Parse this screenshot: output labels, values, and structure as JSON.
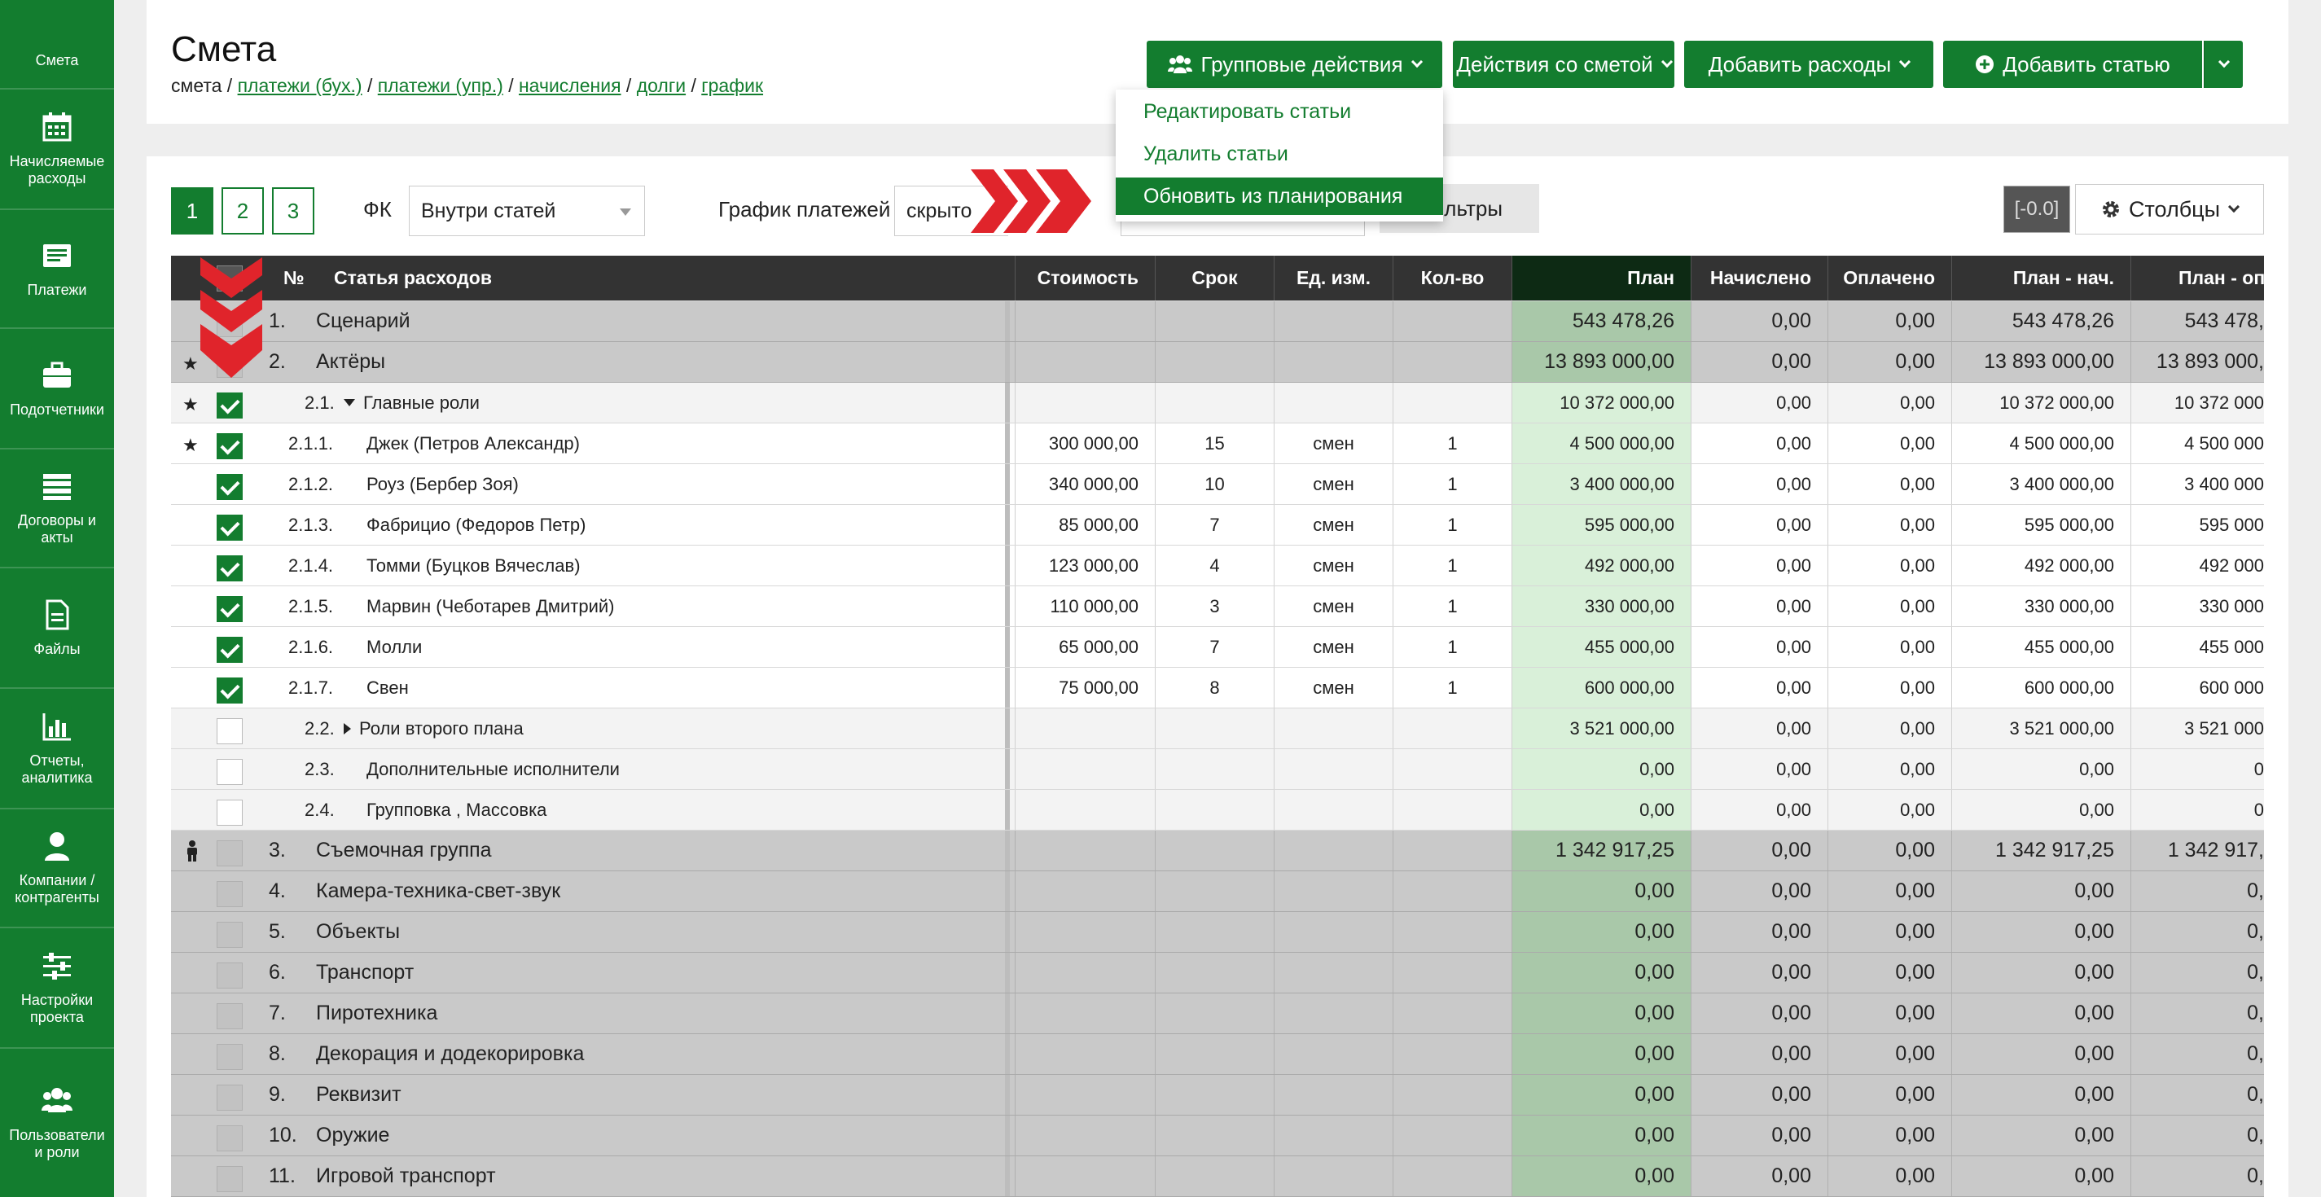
{
  "sidebar": {
    "items": [
      {
        "label": "Смета",
        "icon": "estimate-icon"
      },
      {
        "label": "Начисляемые расходы",
        "icon": "calendar-icon"
      },
      {
        "label": "Платежи",
        "icon": "payments-icon"
      },
      {
        "label": "Подотчетники",
        "icon": "briefcase-icon"
      },
      {
        "label": "Договоры и акты",
        "icon": "list-icon"
      },
      {
        "label": "Файлы",
        "icon": "file-icon"
      },
      {
        "label": "Отчеты, аналитика",
        "icon": "bar-chart-icon"
      },
      {
        "label": "Компании / контрагенты",
        "icon": "user-icon"
      },
      {
        "label": "Настройки проекта",
        "icon": "sliders-icon"
      },
      {
        "label": "Пользователи и роли",
        "icon": "users-icon"
      }
    ]
  },
  "header": {
    "title": "Смета",
    "breadcrumb": {
      "current": "смета",
      "sep": " / ",
      "links": [
        "платежи (бух.)",
        "платежи (упр.)",
        "начисления",
        "долги",
        "график"
      ]
    },
    "buttons": {
      "group_actions": "Групповые действия",
      "estimate_actions": "Действия со сметой",
      "add_expenses": "Добавить расходы",
      "add_item": "Добавить статью"
    }
  },
  "dropdown": {
    "items": [
      "Редактировать статьи",
      "Удалить статьи",
      "Обновить из планирования"
    ],
    "active_index": 2
  },
  "toolbar": {
    "pages": [
      "1",
      "2",
      "3"
    ],
    "active_page": "1",
    "fk_label": "ФК",
    "fk_value": "Внутри статей",
    "schedule_label": "График платежей",
    "schedule_value": "скрыто",
    "filters_label": "Фильтры",
    "badge": "[-0.0]",
    "columns_label": "Столбцы"
  },
  "table": {
    "columns": [
      "№",
      "Статья расходов",
      "Стоимость",
      "Срок",
      "Ед. изм.",
      "Кол-во",
      "План",
      "Начислено",
      "Оплачено",
      "План - нач.",
      "План - оп"
    ],
    "rows": [
      {
        "level": 0,
        "marker": "",
        "checked": false,
        "num": "1.",
        "name": "Сценарий",
        "cost": "",
        "term": "",
        "unit": "",
        "qty": "",
        "plan": "543 478,26",
        "accrued": "0,00",
        "paid": "0,00",
        "plan_acc": "543 478,26",
        "plan_paid": "543 478,"
      },
      {
        "level": 0,
        "marker": "star",
        "checked": false,
        "num": "2.",
        "name": "Актёры",
        "cost": "",
        "term": "",
        "unit": "",
        "qty": "",
        "plan": "13 893 000,00",
        "accrued": "0,00",
        "paid": "0,00",
        "plan_acc": "13 893 000,00",
        "plan_paid": "13 893 000,"
      },
      {
        "level": 1,
        "marker": "star",
        "checked": true,
        "num": "2.1.",
        "toggle": "down",
        "name": "Главные роли",
        "cost": "",
        "term": "",
        "unit": "",
        "qty": "",
        "plan": "10 372 000,00",
        "accrued": "0,00",
        "paid": "0,00",
        "plan_acc": "10 372 000,00",
        "plan_paid": "10 372 000"
      },
      {
        "level": 2,
        "marker": "star",
        "checked": true,
        "num": "2.1.1.",
        "name": "Джек (Петров Александр)",
        "cost": "300 000,00",
        "term": "15",
        "unit": "смен",
        "qty": "1",
        "plan": "4 500 000,00",
        "accrued": "0,00",
        "paid": "0,00",
        "plan_acc": "4 500 000,00",
        "plan_paid": "4 500 000"
      },
      {
        "level": 2,
        "marker": "",
        "checked": true,
        "num": "2.1.2.",
        "name": "Роуз (Бербер Зоя)",
        "cost": "340 000,00",
        "term": "10",
        "unit": "смен",
        "qty": "1",
        "plan": "3 400 000,00",
        "accrued": "0,00",
        "paid": "0,00",
        "plan_acc": "3 400 000,00",
        "plan_paid": "3 400 000"
      },
      {
        "level": 2,
        "marker": "",
        "checked": true,
        "num": "2.1.3.",
        "name": "Фабрицио (Федоров Петр)",
        "cost": "85 000,00",
        "term": "7",
        "unit": "смен",
        "qty": "1",
        "plan": "595 000,00",
        "accrued": "0,00",
        "paid": "0,00",
        "plan_acc": "595 000,00",
        "plan_paid": "595 000"
      },
      {
        "level": 2,
        "marker": "",
        "checked": true,
        "num": "2.1.4.",
        "name": "Томми (Буцков Вячеслав)",
        "cost": "123 000,00",
        "term": "4",
        "unit": "смен",
        "qty": "1",
        "plan": "492 000,00",
        "accrued": "0,00",
        "paid": "0,00",
        "plan_acc": "492 000,00",
        "plan_paid": "492 000"
      },
      {
        "level": 2,
        "marker": "",
        "checked": true,
        "num": "2.1.5.",
        "name": "Марвин (Чеботарев Дмитрий)",
        "cost": "110 000,00",
        "term": "3",
        "unit": "смен",
        "qty": "1",
        "plan": "330 000,00",
        "accrued": "0,00",
        "paid": "0,00",
        "plan_acc": "330 000,00",
        "plan_paid": "330 000"
      },
      {
        "level": 2,
        "marker": "",
        "checked": true,
        "num": "2.1.6.",
        "name": "Молли",
        "cost": "65 000,00",
        "term": "7",
        "unit": "смен",
        "qty": "1",
        "plan": "455 000,00",
        "accrued": "0,00",
        "paid": "0,00",
        "plan_acc": "455 000,00",
        "plan_paid": "455 000"
      },
      {
        "level": 2,
        "marker": "",
        "checked": true,
        "num": "2.1.7.",
        "name": "Свен",
        "cost": "75 000,00",
        "term": "8",
        "unit": "смен",
        "qty": "1",
        "plan": "600 000,00",
        "accrued": "0,00",
        "paid": "0,00",
        "plan_acc": "600 000,00",
        "plan_paid": "600 000"
      },
      {
        "level": 1,
        "marker": "",
        "checked": false,
        "num": "2.2.",
        "toggle": "right",
        "name": "Роли второго плана",
        "cost": "",
        "term": "",
        "unit": "",
        "qty": "",
        "plan": "3 521 000,00",
        "accrued": "0,00",
        "paid": "0,00",
        "plan_acc": "3 521 000,00",
        "plan_paid": "3 521 000"
      },
      {
        "level": 1,
        "marker": "",
        "checked": false,
        "num": "2.3.",
        "name": "Дополнительные исполнители",
        "cost": "",
        "term": "",
        "unit": "",
        "qty": "",
        "plan": "0,00",
        "accrued": "0,00",
        "paid": "0,00",
        "plan_acc": "0,00",
        "plan_paid": "0"
      },
      {
        "level": 1,
        "marker": "",
        "checked": false,
        "num": "2.4.",
        "name": "Групповка , Массовка",
        "cost": "",
        "term": "",
        "unit": "",
        "qty": "",
        "plan": "0,00",
        "accrued": "0,00",
        "paid": "0,00",
        "plan_acc": "0,00",
        "plan_paid": "0"
      },
      {
        "level": 0,
        "marker": "person",
        "checked": false,
        "num": "3.",
        "name": "Съемочная группа",
        "cost": "",
        "term": "",
        "unit": "",
        "qty": "",
        "plan": "1 342 917,25",
        "accrued": "0,00",
        "paid": "0,00",
        "plan_acc": "1 342 917,25",
        "plan_paid": "1 342 917,"
      },
      {
        "level": 0,
        "marker": "",
        "checked": false,
        "num": "4.",
        "name": "Камера-техника-свет-звук",
        "cost": "",
        "term": "",
        "unit": "",
        "qty": "",
        "plan": "0,00",
        "accrued": "0,00",
        "paid": "0,00",
        "plan_acc": "0,00",
        "plan_paid": "0,"
      },
      {
        "level": 0,
        "marker": "",
        "checked": false,
        "num": "5.",
        "name": "Объекты",
        "cost": "",
        "term": "",
        "unit": "",
        "qty": "",
        "plan": "0,00",
        "accrued": "0,00",
        "paid": "0,00",
        "plan_acc": "0,00",
        "plan_paid": "0,"
      },
      {
        "level": 0,
        "marker": "",
        "checked": false,
        "num": "6.",
        "name": "Транспорт",
        "cost": "",
        "term": "",
        "unit": "",
        "qty": "",
        "plan": "0,00",
        "accrued": "0,00",
        "paid": "0,00",
        "plan_acc": "0,00",
        "plan_paid": "0,"
      },
      {
        "level": 0,
        "marker": "",
        "checked": false,
        "num": "7.",
        "name": "Пиротехника",
        "cost": "",
        "term": "",
        "unit": "",
        "qty": "",
        "plan": "0,00",
        "accrued": "0,00",
        "paid": "0,00",
        "plan_acc": "0,00",
        "plan_paid": "0,"
      },
      {
        "level": 0,
        "marker": "",
        "checked": false,
        "num": "8.",
        "name": "Декорация и додекорировка",
        "cost": "",
        "term": "",
        "unit": "",
        "qty": "",
        "plan": "0,00",
        "accrued": "0,00",
        "paid": "0,00",
        "plan_acc": "0,00",
        "plan_paid": "0,"
      },
      {
        "level": 0,
        "marker": "",
        "checked": false,
        "num": "9.",
        "name": "Реквизит",
        "cost": "",
        "term": "",
        "unit": "",
        "qty": "",
        "plan": "0,00",
        "accrued": "0,00",
        "paid": "0,00",
        "plan_acc": "0,00",
        "plan_paid": "0,"
      },
      {
        "level": 0,
        "marker": "",
        "checked": false,
        "num": "10.",
        "name": "Оружие",
        "cost": "",
        "term": "",
        "unit": "",
        "qty": "",
        "plan": "0,00",
        "accrued": "0,00",
        "paid": "0,00",
        "plan_acc": "0,00",
        "plan_paid": "0,"
      },
      {
        "level": 0,
        "marker": "",
        "checked": false,
        "num": "11.",
        "name": "Игровой транспорт",
        "cost": "",
        "term": "",
        "unit": "",
        "qty": "",
        "plan": "0,00",
        "accrued": "0,00",
        "paid": "0,00",
        "plan_acc": "0,00",
        "plan_paid": "0,"
      }
    ]
  },
  "colors": {
    "brand": "#137d2f",
    "header_dark": "#333333",
    "plan_highlight": "#d9f0d9",
    "annotation": "#e0242b"
  }
}
